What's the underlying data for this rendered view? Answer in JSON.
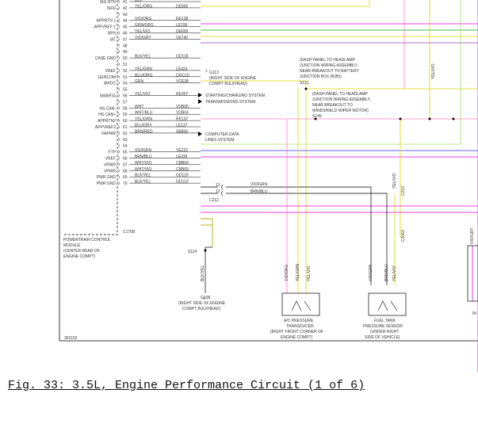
{
  "caption": "Fig. 33: 3.5L, Engine Performance Circuit (1 of 6)",
  "page_code": "301102",
  "colors": {
    "yellow": "#d8d800",
    "magenta": "#e000e0",
    "blue": "#3030ff",
    "green": "#00b000",
    "lightgreen": "#a0e060",
    "pink": "#ff80c0",
    "black": "#000000",
    "orange": "#ffa000",
    "violet": "#9040c0"
  },
  "pins": [
    {
      "n": "41",
      "label": "SIG RTN",
      "color": "BLU",
      "circuit": "",
      "wire": "#3030ff"
    },
    {
      "n": "42",
      "label": "ISFR",
      "color": "YEL/ORG",
      "circuit": "DE600",
      "wire": "#d8d800"
    },
    {
      "n": "43",
      "label": "",
      "color": "",
      "circuit": "",
      "wire": ""
    },
    {
      "n": "44",
      "label": "APPRTN 1",
      "color": "VIO/ORG",
      "circuit": "RE138",
      "wire": "#e000e0"
    },
    {
      "n": "45",
      "label": "APPVREF 1",
      "color": "GRN/ORG",
      "circuit": "LE196",
      "wire": "#00b000"
    },
    {
      "n": "46",
      "label": "BPS",
      "color": "YEL/VIO",
      "circuit": "DE609",
      "wire": "#d8d800"
    },
    {
      "n": "47",
      "label": "IAT",
      "color": "VIO/GRY",
      "circuit": "VE740",
      "wire": "#9040c0"
    },
    {
      "n": "48",
      "label": "",
      "color": "",
      "circuit": "",
      "wire": ""
    },
    {
      "n": "49",
      "label": "",
      "color": "",
      "circuit": "",
      "wire": ""
    },
    {
      "n": "50",
      "label": "CASE GND",
      "color": "BLK/YEL",
      "circuit": "GD118",
      "wire": "#000000"
    },
    {
      "n": "51",
      "label": "",
      "color": "",
      "circuit": "",
      "wire": ""
    },
    {
      "n": "52",
      "label": "VREF",
      "color": "YEL/GRN",
      "circuit": "LE424",
      "wire": "#d8d800"
    },
    {
      "n": "53",
      "label": "GENCOM",
      "color": "BLU/ORG",
      "circuit": "DGC10",
      "wire": "#3030ff"
    },
    {
      "n": "54",
      "label": "AWDC",
      "color": "GRN",
      "circuit": "VCE38",
      "wire": "#00b000"
    },
    {
      "n": "55",
      "label": "",
      "color": "",
      "circuit": "",
      "wire": ""
    },
    {
      "n": "56",
      "label": "SMARTA",
      "color": "YEL/VIO",
      "circuit": "RE407",
      "wire": "#ff80c0"
    },
    {
      "n": "57",
      "label": "",
      "color": "",
      "circuit": "",
      "wire": ""
    },
    {
      "n": "58",
      "label": "HS CAN-",
      "color": "WHT",
      "circuit": "VDB05",
      "wire": "#000000"
    },
    {
      "n": "59",
      "label": "HS CAN+",
      "color": "WHT/BLU",
      "circuit": "VDB04",
      "wire": "#000000"
    },
    {
      "n": "60",
      "label": "APPRTN2",
      "color": "YEL/GRN",
      "circuit": "RE137",
      "wire": "#a0e060"
    },
    {
      "n": "61",
      "label": "APPVREF2",
      "color": "BLU/GRY",
      "circuit": "LE137",
      "wire": "#3030ff"
    },
    {
      "n": "62",
      "label": "FAPWR",
      "color": "BRN/RED",
      "circuit": "SB806",
      "wire": "#e000e0"
    },
    {
      "n": "63",
      "label": "",
      "color": "",
      "circuit": "",
      "wire": ""
    },
    {
      "n": "64",
      "label": "",
      "color": "",
      "circuit": "",
      "wire": ""
    },
    {
      "n": "65",
      "label": "FTP",
      "color": "VIO/GRN",
      "circuit": "VE222",
      "wire": "#000000"
    },
    {
      "n": "66",
      "label": "VREF",
      "color": "BRN/BLU",
      "circuit": "LE236",
      "wire": "#000000"
    },
    {
      "n": "67",
      "label": "VPWR",
      "color": "WHT/VIO",
      "circuit": "CBB69",
      "wire": "#e000e0"
    },
    {
      "n": "68",
      "label": "VPWR",
      "color": "WHT/VIO",
      "circuit": "CBB69",
      "wire": "#e000e0"
    },
    {
      "n": "69",
      "label": "PWR GND",
      "color": "BLK/YEL",
      "circuit": "GD119",
      "wire": "#000000"
    },
    {
      "n": "70",
      "label": "PWR GND",
      "color": "BLK/YEL",
      "circuit": "GD119",
      "wire": "#000000"
    }
  ],
  "connector": "C175B",
  "module_lines": [
    "POWERTRAIN CONTROL",
    "MODULE",
    "(CENTER REAR OF",
    "ENGINE COMPT)"
  ],
  "ground_g": {
    "label": "G108",
    "note1": "(RIGHT SIDE OF ENGINE",
    "note2": "COMPT BULKHEAD)"
  },
  "ground_pin50": {
    "label": "G113",
    "note1": "(RIGHT SIDE OF ENGINE",
    "note2": "COMPT BULKHEAD)"
  },
  "arrows": {
    "charging1": "STARTING/CHARGING SYSTEM",
    "trans": "TRANSMISSIONS SYSTEM",
    "data1": "COMPUTER DATA",
    "data2": "LINES SYSTEM"
  },
  "splice_s121": {
    "l1": "(DASH PANEL TO HEADLAMP",
    "l2": "JUNCTION WIRING ASSEMBLY,",
    "l3": "NEAR BREAKOUT TO BATTERY",
    "l4": "JUNCTION BOX (BJB))",
    "id": "S121"
  },
  "splice_s149": {
    "l1": "(DASH PANEL TO HEADLAMP",
    "l2": "JUNCTION WIRING ASSEMBLY,",
    "l3": "NEAR BREAKOUT TO",
    "l4": "WINDSHIELD WIPER MOTOR)",
    "id": "S149"
  },
  "s114": "S114",
  "blk_yel": "BLK/YEL",
  "c212": "C212",
  "c212_pins": [
    "13",
    "12"
  ],
  "c212_wires": [
    "VIO/GRN",
    "BRN/BLU"
  ],
  "yelvio_top": "YEL/VIO",
  "yelvio_c213": "YEL/VIO",
  "c213": "C213",
  "c3063": "C3063",
  "vioory": "VIO/GRY",
  "in_label": "IN",
  "ac_sensor": {
    "wires": [
      "VIO/ORG",
      "YEL/GRN",
      "YEL/VIO"
    ],
    "l1": "A/C PRESSURE",
    "l2": "TRANSDUCER",
    "l3": "(RIGHT FRONT CORNER OF",
    "l4": "ENGINE COMPT)"
  },
  "fuel_sensor": {
    "wires": [
      "VIO/GRN",
      "BRN/BLU",
      "YEL/VIO"
    ],
    "l1": "FUEL TANK",
    "l2": "PRESSURE SENSOR",
    "l3": "(UNDER RIGHT",
    "l4": "SIDE OF VEHICLE)"
  }
}
